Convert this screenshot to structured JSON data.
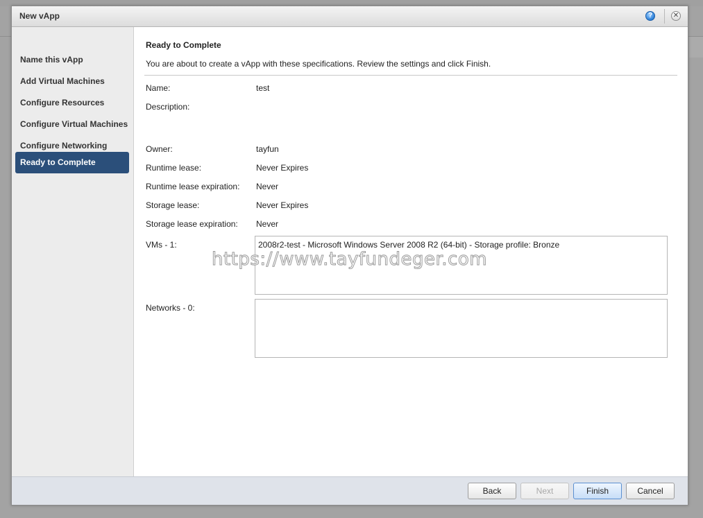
{
  "dialog": {
    "title": "New vApp",
    "help_icon": "help-icon",
    "close_icon": "close-icon"
  },
  "sidebar": {
    "items": [
      {
        "label": "Name this vApp",
        "active": false
      },
      {
        "label": "Add Virtual Machines",
        "active": false
      },
      {
        "label": "Configure Resources",
        "active": false
      },
      {
        "label": "Configure Virtual Machines",
        "active": false
      },
      {
        "label": "Configure Networking",
        "active": false
      },
      {
        "label": "Ready to Complete",
        "active": true
      }
    ]
  },
  "content": {
    "heading": "Ready to Complete",
    "intro": "You are about to create a vApp with these specifications. Review the settings and click Finish.",
    "fields": {
      "name": {
        "label": "Name:",
        "value": "test"
      },
      "description": {
        "label": "Description:",
        "value": ""
      },
      "owner": {
        "label": "Owner:",
        "value": "tayfun"
      },
      "runtime_lease": {
        "label": "Runtime lease:",
        "value": "Never Expires"
      },
      "runtime_lease_expiration": {
        "label": "Runtime lease expiration:",
        "value": "Never"
      },
      "storage_lease": {
        "label": "Storage lease:",
        "value": "Never Expires"
      },
      "storage_lease_expiration": {
        "label": "Storage lease expiration:",
        "value": "Never"
      }
    },
    "vms": {
      "label": "VMs - 1:",
      "items": [
        "2008r2-test - Microsoft Windows Server 2008 R2 (64-bit) - Storage profile: Bronze"
      ]
    },
    "networks": {
      "label": "Networks - 0:",
      "items": []
    },
    "watermark": "https://www.tayfundeger.com"
  },
  "footer": {
    "back": "Back",
    "next": "Next",
    "finish": "Finish",
    "cancel": "Cancel"
  }
}
